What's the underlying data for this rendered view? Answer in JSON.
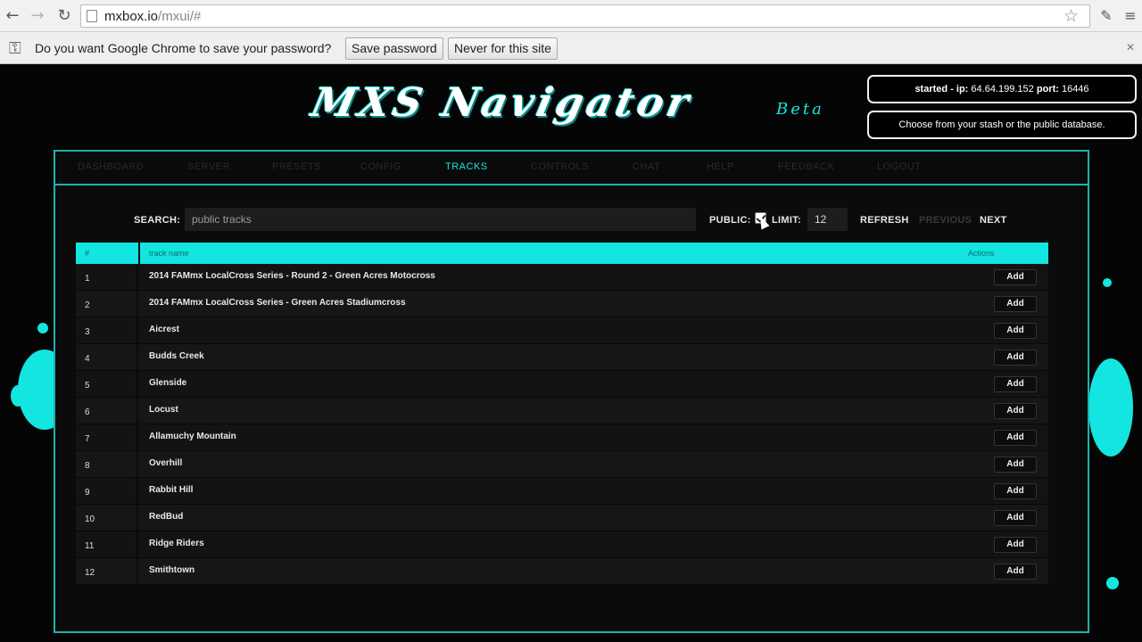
{
  "browser": {
    "url_host": "mxbox.io",
    "url_path": "/mxui/#",
    "infobar_text": "Do you want Google Chrome to save your password?",
    "save_password_label": "Save password",
    "never_label": "Never for this site",
    "close_glyph": "✕"
  },
  "header": {
    "logo_text": "MXS Navigator",
    "logo_beta": "Beta",
    "status_started": "started",
    "status_ip_label": "- ip:",
    "status_ip": "64.64.199.152",
    "status_port_label": "port:",
    "status_port": "16446",
    "status_hint": "Choose from your stash or the public database."
  },
  "nav": {
    "items": [
      "DASHBOARD",
      "SERVER",
      "PRESETS",
      "CONFIG",
      "TRACKS",
      "CONTROLS",
      "CHAT",
      "HELP",
      "FEEDBACK",
      "LOGOUT"
    ],
    "active": "TRACKS"
  },
  "toolbar": {
    "search_label": "SEARCH:",
    "search_value": "public tracks",
    "public_label": "PUBLIC:",
    "limit_label": "LIMIT:",
    "limit_value": "12",
    "refresh_label": "REFRESH",
    "previous_label": "PREVIOUS",
    "next_label": "NEXT"
  },
  "table": {
    "columns": [
      "#",
      "track name",
      "Actions"
    ],
    "action_label": "Add",
    "rows": [
      {
        "num": "1",
        "name": "2014 FAMmx LocalCross Series - Round 2 - Green Acres Motocross"
      },
      {
        "num": "2",
        "name": "2014 FAMmx LocalCross Series - Green Acres Stadiumcross"
      },
      {
        "num": "3",
        "name": "Aicrest"
      },
      {
        "num": "4",
        "name": "Budds Creek"
      },
      {
        "num": "5",
        "name": "Glenside"
      },
      {
        "num": "6",
        "name": "Locust"
      },
      {
        "num": "7",
        "name": "Allamuchy Mountain"
      },
      {
        "num": "8",
        "name": "Overhill"
      },
      {
        "num": "9",
        "name": "Rabbit Hill"
      },
      {
        "num": "10",
        "name": "RedBud"
      },
      {
        "num": "11",
        "name": "Ridge Riders"
      },
      {
        "num": "12",
        "name": "Smithtown"
      }
    ]
  },
  "colors": {
    "accent": "#13e5e0",
    "nav_inactive": "#2a2a2a",
    "previous_disabled": "#3a3a3a"
  }
}
